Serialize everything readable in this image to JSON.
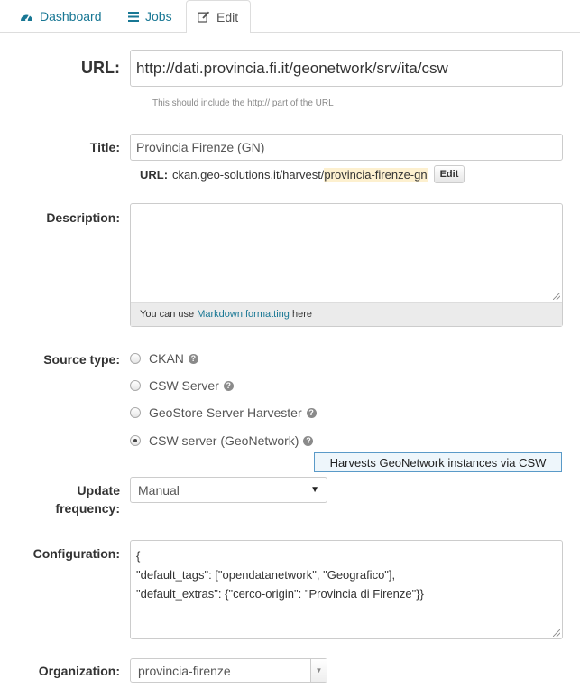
{
  "tabs": [
    {
      "label": "Dashboard",
      "icon": "dashboard-icon"
    },
    {
      "label": "Jobs",
      "icon": "list-icon"
    },
    {
      "label": "Edit",
      "icon": "edit-icon"
    }
  ],
  "url_field": {
    "label": "URL:",
    "value": "http://dati.provincia.fi.it/geonetwork/srv/ita/csw",
    "help": "This should include the http:// part of the URL"
  },
  "title_field": {
    "label": "Title:",
    "value": "Provincia Firenze (GN)",
    "slug_label": "URL:",
    "slug_prefix": "ckan.geo-solutions.it/harvest/",
    "slug_value": "provincia-firenze-gn",
    "slug_edit": "Edit"
  },
  "description": {
    "label": "Description:",
    "value": "",
    "footer_prefix": "You can use ",
    "footer_link": "Markdown formatting",
    "footer_suffix": " here"
  },
  "source_type": {
    "label": "Source type:",
    "options": [
      {
        "label": "CKAN",
        "checked": false
      },
      {
        "label": "CSW Server",
        "checked": false
      },
      {
        "label": "GeoStore Server Harvester",
        "checked": false
      },
      {
        "label": "CSW server (GeoNetwork)",
        "checked": true
      }
    ],
    "tooltip": "Harvests GeoNetwork instances via CSW"
  },
  "update_frequency": {
    "label_line1": "Update",
    "label_line2": "frequency:",
    "value": "Manual"
  },
  "configuration": {
    "label": "Configuration:",
    "line1": "{",
    "line2": "\"default_tags\": [\"opendatanetwork\", \"Geografico\"],",
    "line3": "\"default_extras\": {\"cerco-origin\": \"Provincia di Firenze\"}}"
  },
  "organization": {
    "label": "Organization:",
    "value": "provincia-firenze"
  },
  "colors": {
    "link": "#187794",
    "highlight": "#fdf0cf",
    "tooltip_bg": "#eef6fb",
    "tooltip_border": "#5a9ac8"
  }
}
